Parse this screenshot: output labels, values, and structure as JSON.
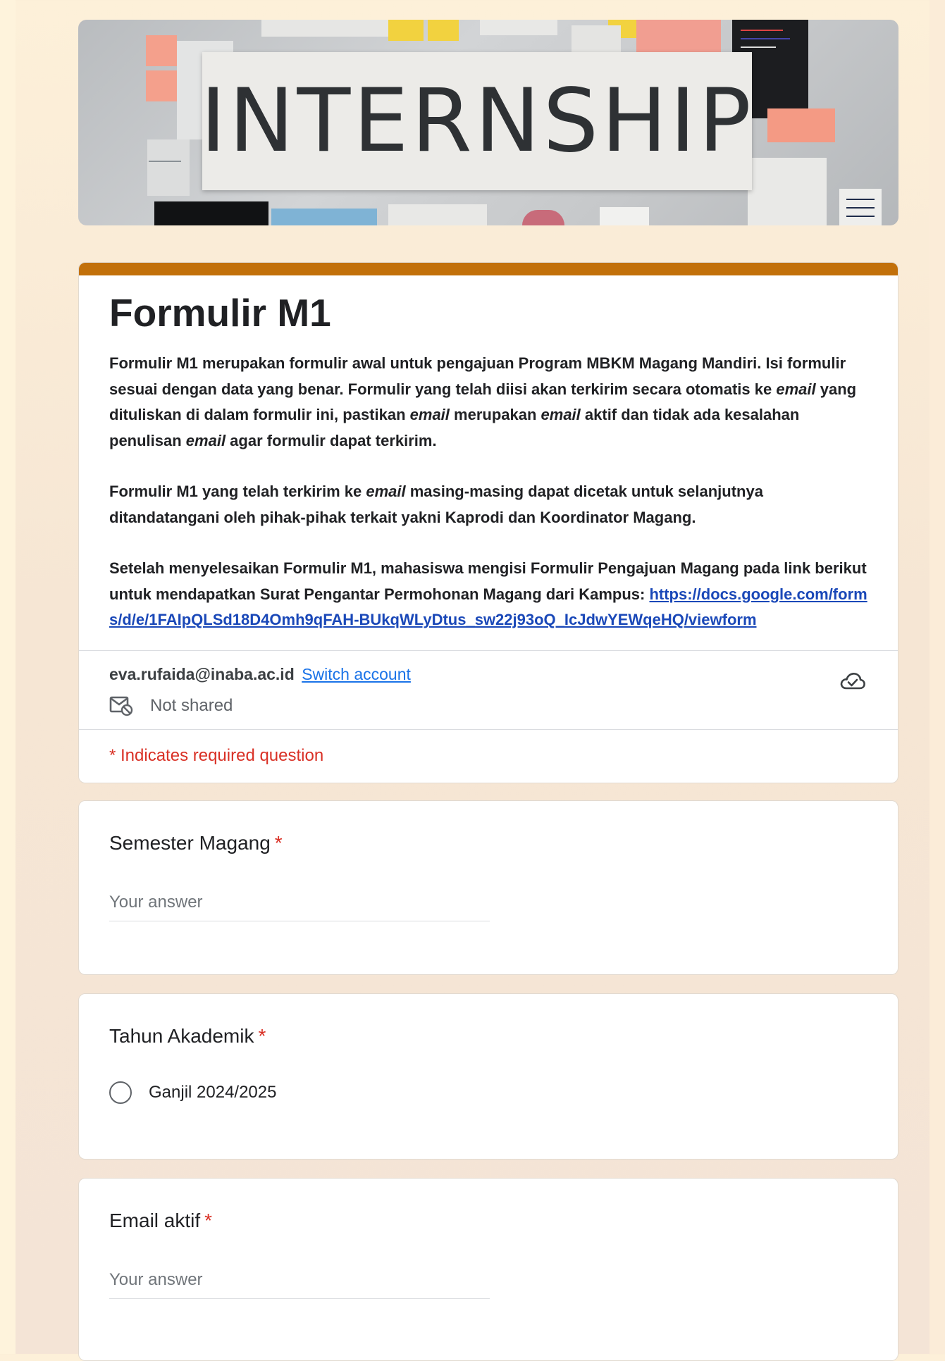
{
  "banner": {
    "title": "INTERNSHIP"
  },
  "form": {
    "title": "Formulir M1",
    "description": {
      "p1_part1": "Formulir M1 merupakan formulir awal untuk pengajuan Program MBKM Magang Mandiri. Isi formulir sesuai dengan data yang benar. Formulir yang telah diisi akan terkirim secara otomatis ke ",
      "p1_em1": "email",
      "p1_part2": " yang dituliskan di dalam formulir ini, pastikan ",
      "p1_em2": "email",
      "p1_part3": " merupakan ",
      "p1_em3": "email",
      "p1_part4": " aktif dan tidak ada kesalahan penulisan ",
      "p1_em4": "email",
      "p1_part5": " agar formulir dapat terkirim.",
      "p2_part1": "Formulir M1 yang telah terkirim ke ",
      "p2_em1": "email",
      "p2_part2": " masing-masing dapat dicetak untuk selanjutnya ditandatangani oleh pihak-pihak terkait yakni Kaprodi dan Koordinator Magang.",
      "p3_text": "Setelah menyelesaikan Formulir M1, mahasiswa mengisi Formulir Pengajuan Magang pada link berikut untuk mendapatkan Surat Pengantar Permohonan Magang dari Kampus: ",
      "p3_link": "https://docs.google.com/forms/d/e/1FAIpQLSd18D4Omh9qFAH-BUkqWLyDtus_sw22j93oQ_IcJdwYEWqeHQ/viewform"
    }
  },
  "account": {
    "email": "eva.rufaida@inaba.ac.id",
    "switch_label": "Switch account",
    "not_shared_label": "Not shared"
  },
  "required_note": "* Indicates required question",
  "questions": [
    {
      "title": "Semester Magang",
      "required_mark": "*",
      "placeholder": "Your answer"
    },
    {
      "title": "Tahun Akademik",
      "required_mark": "*",
      "options": [
        "Ganjil 2024/2025"
      ]
    },
    {
      "title": "Email aktif",
      "required_mark": "*",
      "placeholder": "Your answer"
    }
  ],
  "colors": {
    "accent": "#c2700a",
    "required": "#d93025",
    "link": "#1a73e8"
  }
}
